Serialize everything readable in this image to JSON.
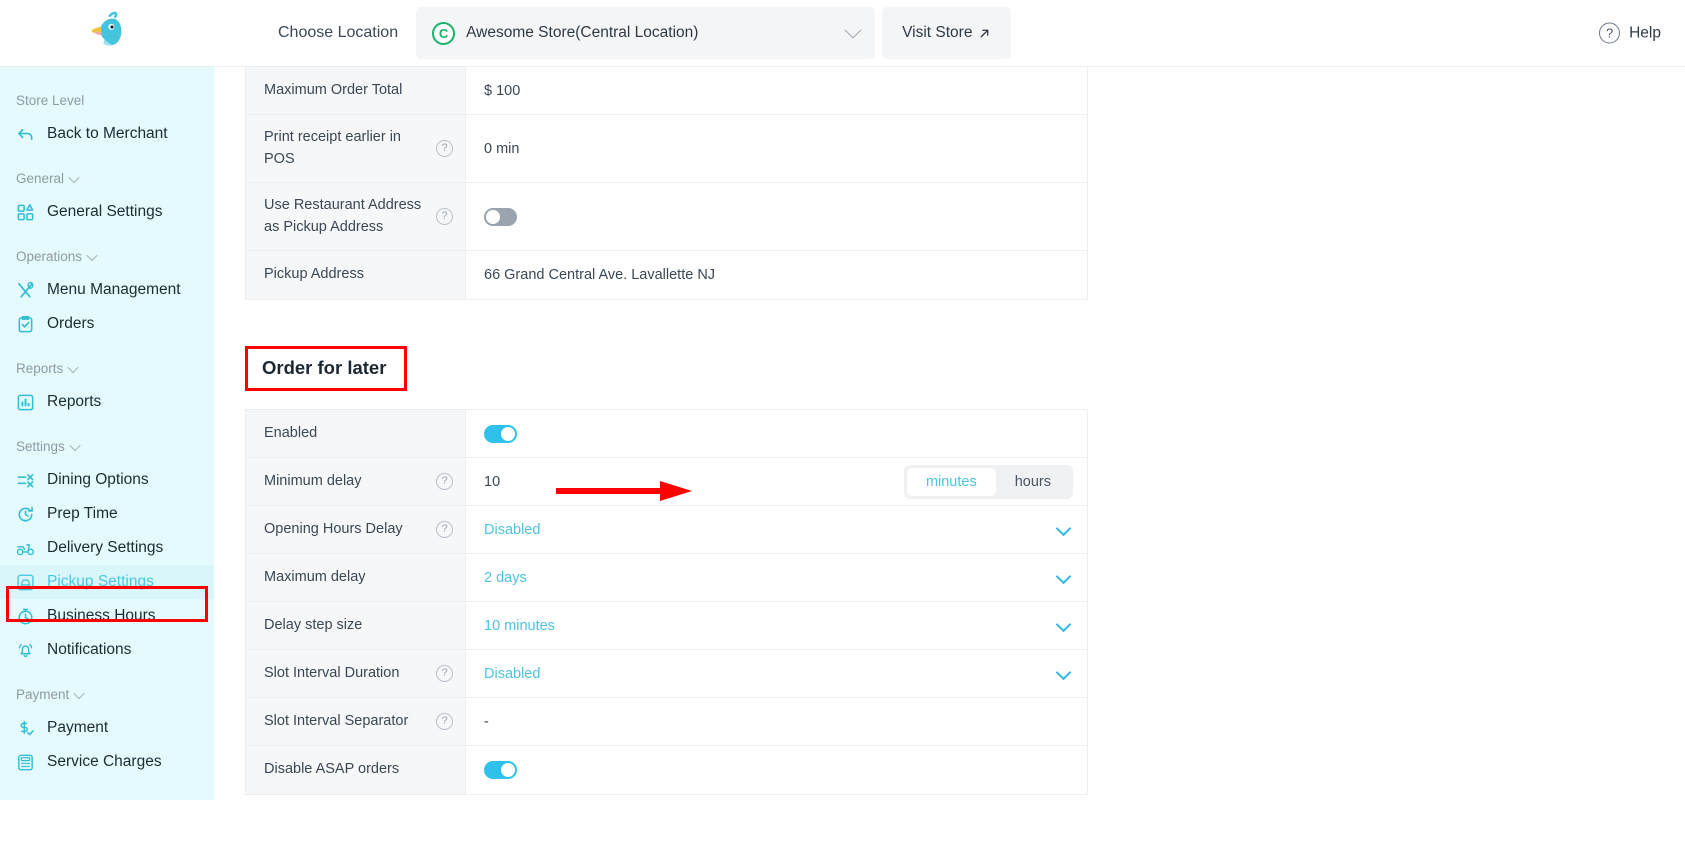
{
  "header": {
    "choose_location_label": "Choose Location",
    "location_badge": "C",
    "location_name": "Awesome Store(Central Location)",
    "visit_store_label": "Visit Store",
    "visit_store_icon": "external-link-icon",
    "dropdown_icon": "chevron-down-icon",
    "help_label": "Help",
    "help_icon": "question-circle-icon",
    "logo_icon": "parrot-logo-icon"
  },
  "sidebar": {
    "groups": [
      {
        "title": "Store Level",
        "collapsible": false,
        "items": [
          {
            "label": "Back to Merchant",
            "icon": "back-arrow-icon",
            "active": false
          }
        ]
      },
      {
        "title": "General",
        "collapsible": true,
        "items": [
          {
            "label": "General Settings",
            "icon": "grid-squares-icon",
            "active": false
          }
        ]
      },
      {
        "title": "Operations",
        "collapsible": true,
        "items": [
          {
            "label": "Menu Management",
            "icon": "fork-spoon-icon",
            "active": false
          },
          {
            "label": "Orders",
            "icon": "clipboard-check-icon",
            "active": false
          }
        ]
      },
      {
        "title": "Reports",
        "collapsible": true,
        "items": [
          {
            "label": "Reports",
            "icon": "bar-chart-icon",
            "active": false
          }
        ]
      },
      {
        "title": "Settings",
        "collapsible": true,
        "items": [
          {
            "label": "Dining Options",
            "icon": "sliders-icon",
            "active": false
          },
          {
            "label": "Prep Time",
            "icon": "clock-refresh-icon",
            "active": false
          },
          {
            "label": "Delivery Settings",
            "icon": "scooter-icon",
            "active": false
          },
          {
            "label": "Pickup Settings",
            "icon": "pickup-car-icon",
            "active": true
          },
          {
            "label": "Business Hours",
            "icon": "stopwatch-icon",
            "active": false
          },
          {
            "label": "Notifications",
            "icon": "bell-ring-icon",
            "active": false
          }
        ]
      },
      {
        "title": "Payment",
        "collapsible": true,
        "items": [
          {
            "label": "Payment",
            "icon": "dollar-check-icon",
            "active": false
          },
          {
            "label": "Service Charges",
            "icon": "calculator-icon",
            "active": false
          }
        ]
      }
    ]
  },
  "main": {
    "top_rows": [
      {
        "label": "Maximum Order Total",
        "help": false,
        "type": "text",
        "value": "$ 100"
      },
      {
        "label": "Print receipt earlier in POS",
        "help": true,
        "type": "text",
        "value": "0 min"
      },
      {
        "label": "Use Restaurant Address as Pickup Address",
        "help": true,
        "type": "toggle",
        "toggle_state": "off",
        "value": ""
      },
      {
        "label": "Pickup Address",
        "help": false,
        "type": "text",
        "value": "66 Grand Central Ave. Lavallette NJ"
      }
    ],
    "section": {
      "title": "Order for later",
      "highlighted": true,
      "rows": [
        {
          "label": "Enabled",
          "help": false,
          "type": "toggle",
          "toggle_state": "on",
          "value": "",
          "annotated_arrow": true
        },
        {
          "label": "Minimum delay",
          "help": true,
          "type": "segmented",
          "value": "10",
          "options": [
            "minutes",
            "hours"
          ],
          "selected_option": "minutes"
        },
        {
          "label": "Opening Hours Delay",
          "help": true,
          "type": "dropdown",
          "value": "Disabled"
        },
        {
          "label": "Maximum delay",
          "help": false,
          "type": "dropdown",
          "value": "2 days"
        },
        {
          "label": "Delay step size",
          "help": false,
          "type": "dropdown",
          "value": "10 minutes"
        },
        {
          "label": "Slot Interval Duration",
          "help": true,
          "type": "dropdown",
          "value": "Disabled"
        },
        {
          "label": "Slot Interval Separator",
          "help": true,
          "type": "text",
          "value": "-"
        },
        {
          "label": "Disable ASAP orders",
          "help": false,
          "type": "toggle",
          "toggle_state": "on",
          "value": ""
        }
      ]
    }
  },
  "colors": {
    "accent": "#4ec3e0",
    "sidebar_bg": "#e4fafc",
    "annotation_red": "#ff0000",
    "toggle_on": "#2fc1ec",
    "toggle_off": "#9aa4ae",
    "badge_green": "#17b26a"
  }
}
